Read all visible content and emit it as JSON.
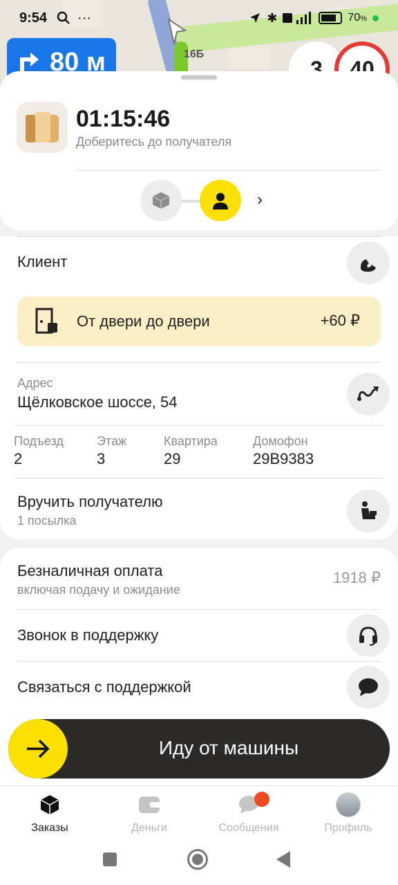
{
  "status_bar": {
    "time": "9:54",
    "battery": "70",
    "battery_unit": "%"
  },
  "map": {
    "maneuver_distance": "80 м",
    "house_number": "16Б",
    "lanes_number": "3",
    "speed_limit": "40"
  },
  "order": {
    "timer": "01:15:46",
    "subtitle": "Доберитесь до получателя"
  },
  "client": {
    "label": "Клиент"
  },
  "promo": {
    "text": "От двери до двери",
    "price": "+60 ₽"
  },
  "address": {
    "label": "Адрес",
    "value": "Щёлковское шоссе, 54"
  },
  "details": [
    {
      "label": "Подъезд",
      "value": "2"
    },
    {
      "label": "Этаж",
      "value": "3"
    },
    {
      "label": "Квартира",
      "value": "29"
    },
    {
      "label": "Домофон",
      "value": "29В9383"
    }
  ],
  "handover": {
    "title": "Вручить получателю",
    "subtitle": "1 посылка"
  },
  "payment": {
    "title": "Безналичная оплата",
    "subtitle": "включая подачу и ожидание",
    "amount": "1918 ₽"
  },
  "support": {
    "call": "Звонок в поддержку",
    "chat": "Связаться с поддержкой"
  },
  "action": {
    "label": "Иду от машины"
  },
  "tabs": [
    {
      "label": "Заказы",
      "icon": "box-icon"
    },
    {
      "label": "Деньги",
      "icon": "wallet-icon"
    },
    {
      "label": "Сообщения",
      "icon": "chat-icon"
    },
    {
      "label": "Профиль",
      "icon": "avatar"
    }
  ],
  "colors": {
    "accent_yellow": "#fce000",
    "promo_bg": "#fcefc6",
    "button_dark": "#2b2a29",
    "nav_blue": "#1976e8",
    "limit_red": "#e53935"
  }
}
